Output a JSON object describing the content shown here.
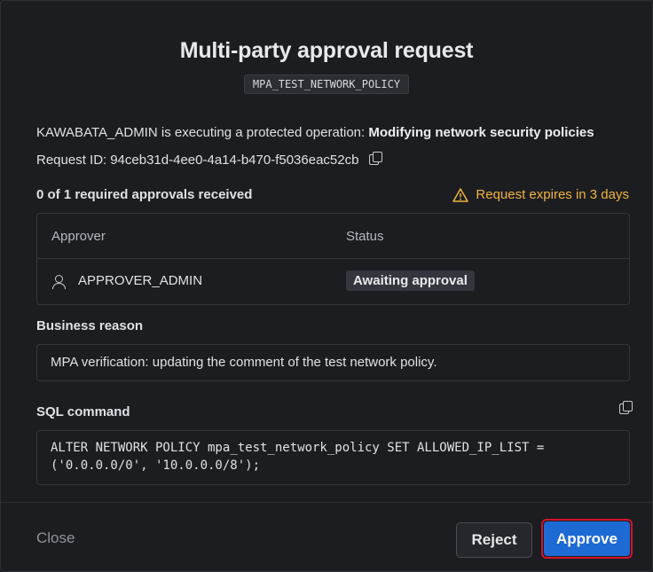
{
  "dialog": {
    "title": "Multi-party approval request",
    "tag": "MPA_TEST_NETWORK_POLICY"
  },
  "operation": {
    "user": "KAWABATA_ADMIN",
    "middle_text": " is executing a protected operation: ",
    "operation_name": "Modifying network security policies",
    "request_id_label": "Request ID: ",
    "request_id": "94ceb31d-4ee0-4a14-b470-f5036eac52cb"
  },
  "approvals": {
    "summary": "0 of 1 required approvals received",
    "expires": "Request expires in 3 days",
    "warning_color": "#f0b43a",
    "columns": [
      "Approver",
      "Status"
    ],
    "rows": [
      {
        "approver": "APPROVER_ADMIN",
        "icon": "person-icon",
        "status": "Awaiting approval"
      }
    ]
  },
  "business_reason": {
    "label": "Business reason",
    "text": "MPA verification: updating the comment of the test network policy."
  },
  "sql": {
    "label": "SQL command",
    "text": "ALTER NETWORK POLICY mpa_test_network_policy SET ALLOWED_IP_LIST =\n('0.0.0.0/0', '10.0.0.0/8');"
  },
  "footer": {
    "close_label": "Close",
    "reject_label": "Reject",
    "approve_label": "Approve",
    "approve_color": "#1e6ad4",
    "highlight_color": "#d3132a"
  }
}
